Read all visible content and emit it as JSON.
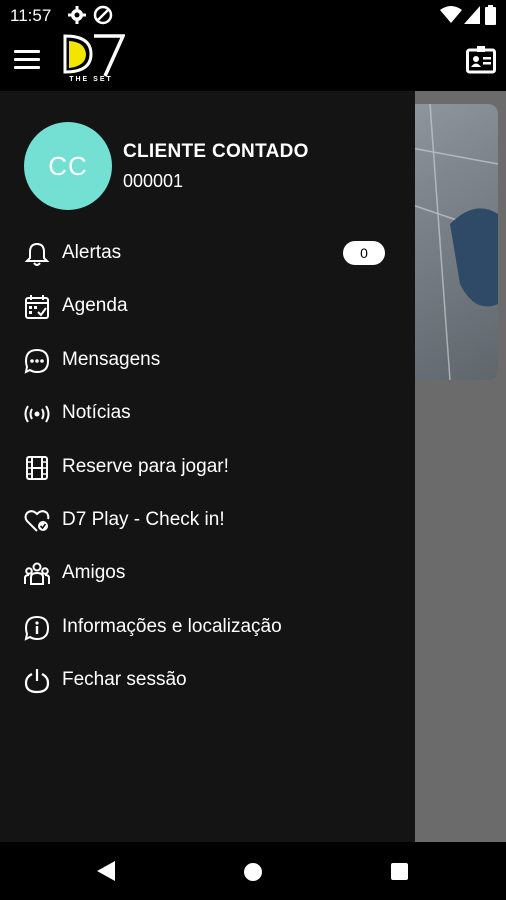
{
  "status_bar": {
    "time": "11:57"
  },
  "app_bar": {
    "logo_text": "D7",
    "logo_subtext": "THE SET"
  },
  "user": {
    "initials": "CC",
    "name": "CLIENTE CONTADO",
    "id": "000001",
    "avatar_color": "#74e0d3"
  },
  "menu": {
    "items": [
      {
        "label": "Alertas",
        "icon": "bell-icon",
        "badge": "0"
      },
      {
        "label": "Agenda",
        "icon": "calendar-icon"
      },
      {
        "label": "Mensagens",
        "icon": "chat-icon"
      },
      {
        "label": "Notícias",
        "icon": "broadcast-icon"
      },
      {
        "label": "Reserve para jogar!",
        "icon": "film-icon"
      },
      {
        "label": "D7 Play - Check in!",
        "icon": "heart-check-icon"
      },
      {
        "label": "Amigos",
        "icon": "friends-icon"
      },
      {
        "label": "Informações e localização",
        "icon": "info-icon"
      },
      {
        "label": "Fechar sessão",
        "icon": "power-icon"
      }
    ]
  },
  "colors": {
    "drawer_bg": "#141414",
    "accent_logo": "#f2e500"
  }
}
